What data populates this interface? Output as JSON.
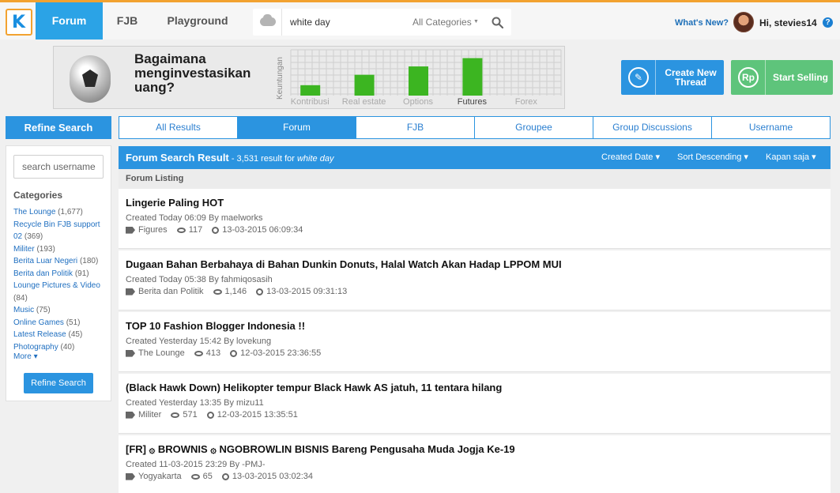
{
  "colors": {
    "accent": "#2b94e0",
    "brand_orange": "#f2a230",
    "sell_green": "#5ec47b"
  },
  "nav": {
    "logo_icon": "kaskus-logo-icon",
    "tabs": [
      {
        "label": "Forum",
        "active": true
      },
      {
        "label": "FJB",
        "active": false
      },
      {
        "label": "Playground",
        "active": false
      }
    ],
    "search": {
      "value": "white day",
      "category": "All Categories"
    },
    "whats_new": "What's New?",
    "greeting": "Hi, stevies14",
    "help_icon": "?"
  },
  "banner": {
    "lines": [
      "Bagaimana",
      "menginvestasikan",
      "uang?"
    ],
    "chart_data": {
      "type": "bar",
      "ylabel": "Keuntungan",
      "categories": [
        "Kontribusi",
        "Real estate",
        "Options",
        "Futures",
        "Forex"
      ],
      "values": [
        1,
        2,
        2.8,
        3.6,
        0
      ]
    }
  },
  "cta": {
    "create": {
      "line1": "Create New",
      "line2": "Thread",
      "icon": "pencil-icon"
    },
    "sell": {
      "label": "Start Selling",
      "icon_text": "Rp"
    }
  },
  "sidebar": {
    "header": "Refine Search",
    "username_placeholder": "search username",
    "categories_title": "Categories",
    "categories": [
      {
        "name": "The Lounge",
        "count": "(1,677)"
      },
      {
        "name": "Recycle Bin FJB support 02",
        "count": "(369)"
      },
      {
        "name": "Militer",
        "count": "(193)"
      },
      {
        "name": "Berita Luar Negeri",
        "count": "(180)"
      },
      {
        "name": "Berita dan Politik",
        "count": "(91)"
      },
      {
        "name": "Lounge Pictures & Video",
        "count": "(84)"
      },
      {
        "name": "Music",
        "count": "(75)"
      },
      {
        "name": "Online Games",
        "count": "(51)"
      },
      {
        "name": "Latest Release",
        "count": "(45)"
      },
      {
        "name": "Photography",
        "count": "(40)"
      }
    ],
    "more": "More",
    "refine_button": "Refine Search"
  },
  "filter_tabs": [
    {
      "label": "All Results",
      "active": false
    },
    {
      "label": "Forum",
      "active": true
    },
    {
      "label": "FJB",
      "active": false
    },
    {
      "label": "Groupee",
      "active": false
    },
    {
      "label": "Group Discussions",
      "active": false
    },
    {
      "label": "Username",
      "active": false
    }
  ],
  "result_bar": {
    "title": "Forum Search Result",
    "count_text": " - 3,531 result for ",
    "query": "white day",
    "sort_date": "Created Date",
    "sort_order": "Sort Descending",
    "time_filter": "Kapan saja"
  },
  "listing_label": "Forum Listing",
  "threads": [
    {
      "title": "Lingerie Paling HOT",
      "meta": "Created Today 06:09 By maelworks",
      "category": "Figures",
      "views": "117",
      "last": "13-03-2015 06:09:34"
    },
    {
      "title": "Dugaan Bahan Berbahaya di Bahan Dunkin Donuts, Halal Watch Akan Hadap LPPOM MUI",
      "meta": "Created Today 05:38 By fahmiqosasih",
      "category": "Berita dan Politik",
      "views": "1,146",
      "last": "13-03-2015 09:31:13"
    },
    {
      "title": "TOP 10 Fashion Blogger Indonesia !!",
      "meta": "Created Yesterday 15:42 By lovekung",
      "category": "The Lounge",
      "views": "413",
      "last": "12-03-2015 23:36:55"
    },
    {
      "title": "(Black Hawk Down) Helikopter tempur Black Hawk AS jatuh, 11 tentara hilang",
      "meta": "Created Yesterday 13:35 By mizu11",
      "category": "Militer",
      "views": "571",
      "last": "12-03-2015 13:35:51"
    },
    {
      "title": "[FR] ۞ BROWNIS ۞ NGOBROWLIN BISNIS Bareng Pengusaha Muda Jogja Ke-19",
      "meta": "Created 11-03-2015 23:29 By -PMJ-",
      "category": "Yogyakarta",
      "views": "65",
      "last": "13-03-2015 03:02:34"
    }
  ]
}
